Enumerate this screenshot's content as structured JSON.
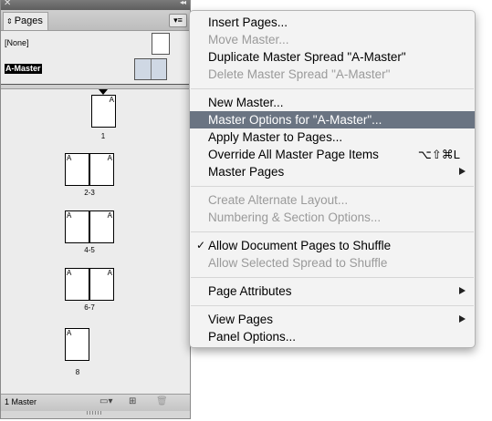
{
  "panel": {
    "tab_label": "Pages",
    "none_master_label": "[None]",
    "selected_master_label": "A-Master",
    "footer_label": "1 Master",
    "pages": [
      {
        "prefix_right": "A",
        "number": "1"
      },
      {
        "prefix_left": "A",
        "prefix_right": "A",
        "number": "2-3"
      },
      {
        "prefix_left": "A",
        "prefix_right": "A",
        "number": "4-5"
      },
      {
        "prefix_left": "A",
        "prefix_right": "A",
        "number": "6-7"
      },
      {
        "prefix_left": "A",
        "number": "8"
      }
    ],
    "icons": [
      "close-icon",
      "collapse-icon",
      "panel-menu-icon",
      "edit-page-size-icon",
      "new-page-icon",
      "trash-icon"
    ]
  },
  "menu": {
    "items": [
      {
        "label": "Insert Pages...",
        "enabled": true
      },
      {
        "label": "Move Master...",
        "enabled": false
      },
      {
        "label": "Duplicate Master Spread \"A-Master\"",
        "enabled": true
      },
      {
        "label": "Delete Master Spread \"A-Master\"",
        "enabled": false
      },
      {
        "label": "New Master...",
        "enabled": true
      },
      {
        "label": "Master Options for \"A-Master\"...",
        "enabled": true,
        "highlighted": true
      },
      {
        "label": "Apply Master to Pages...",
        "enabled": true
      },
      {
        "label": "Override All Master Page Items",
        "enabled": true,
        "shortcut": "⌥⇧⌘L"
      },
      {
        "label": "Master Pages",
        "enabled": true,
        "submenu": true
      },
      {
        "label": "Create Alternate Layout...",
        "enabled": false
      },
      {
        "label": "Numbering & Section Options...",
        "enabled": false
      },
      {
        "label": "Allow Document Pages to Shuffle",
        "enabled": true,
        "checked": true
      },
      {
        "label": "Allow Selected Spread to Shuffle",
        "enabled": false
      },
      {
        "label": "Page Attributes",
        "enabled": true,
        "submenu": true
      },
      {
        "label": "View Pages",
        "enabled": true,
        "submenu": true
      },
      {
        "label": "Panel Options...",
        "enabled": true
      }
    ],
    "check_mark": "✓",
    "highlight_color": "#6a7482"
  }
}
